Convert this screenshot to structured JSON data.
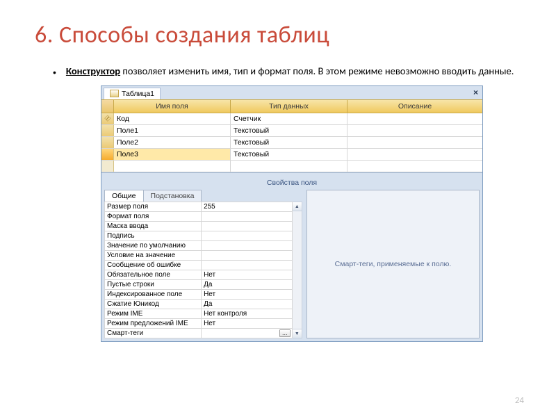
{
  "slide": {
    "title": "6. Способы создания таблиц",
    "bullet_lead": "Конструктор",
    "bullet_rest": " позволяет изменить имя, тип и формат поля. В этом режиме невозможно вводить данные.",
    "page_number": "24"
  },
  "access": {
    "tab_label": "Таблица1",
    "close": "×",
    "columns": {
      "name": "Имя поля",
      "type": "Тип данных",
      "desc": "Описание"
    },
    "rows": [
      {
        "key": true,
        "name": "Код",
        "type": "Счетчик",
        "selected": false
      },
      {
        "name": "Поле1",
        "type": "Текстовый",
        "selected": false
      },
      {
        "name": "Поле2",
        "type": "Текстовый",
        "selected": false
      },
      {
        "name": "Поле3",
        "type": "Текстовый",
        "selected": true
      }
    ],
    "props_title": "Свойства поля",
    "prop_tabs": {
      "general": "Общие",
      "lookup": "Подстановка"
    },
    "props": [
      {
        "label": "Размер поля",
        "value": "255"
      },
      {
        "label": "Формат поля",
        "value": ""
      },
      {
        "label": "Маска ввода",
        "value": ""
      },
      {
        "label": "Подпись",
        "value": ""
      },
      {
        "label": "Значение по умолчанию",
        "value": ""
      },
      {
        "label": "Условие на значение",
        "value": ""
      },
      {
        "label": "Сообщение об ошибке",
        "value": ""
      },
      {
        "label": "Обязательное поле",
        "value": "Нет"
      },
      {
        "label": "Пустые строки",
        "value": "Да"
      },
      {
        "label": "Индексированное поле",
        "value": "Нет"
      },
      {
        "label": "Сжатие Юникод",
        "value": "Да"
      },
      {
        "label": "Режим IME",
        "value": "Нет контроля"
      },
      {
        "label": "Режим предложений IME",
        "value": "Нет"
      },
      {
        "label": "Смарт-теги",
        "value": ""
      }
    ],
    "more_btn": "…",
    "scroll_up": "▲",
    "scroll_down": "▼",
    "hint": "Смарт-теги, применяемые к полю."
  }
}
